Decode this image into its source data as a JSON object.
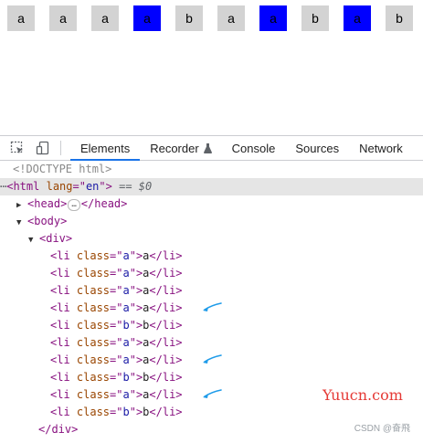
{
  "preview": {
    "boxes": [
      {
        "text": "a",
        "highlight": false
      },
      {
        "text": "a",
        "highlight": false
      },
      {
        "text": "a",
        "highlight": false
      },
      {
        "text": "a",
        "highlight": true
      },
      {
        "text": "b",
        "highlight": false
      },
      {
        "text": "a",
        "highlight": false
      },
      {
        "text": "a",
        "highlight": true
      },
      {
        "text": "b",
        "highlight": false
      },
      {
        "text": "a",
        "highlight": true
      },
      {
        "text": "b",
        "highlight": false
      }
    ],
    "colors": {
      "gray": "#d3d3d3",
      "blue": "#0000ff"
    }
  },
  "devtools": {
    "tabs": [
      "Elements",
      "Recorder",
      "Console",
      "Sources",
      "Network"
    ],
    "active_tab": "Elements",
    "recorder_icon": "flask-icon",
    "toolbar_icons": [
      "inspect-element-icon",
      "device-toggle-icon"
    ],
    "dom": {
      "doctype": "<!DOCTYPE html>",
      "html_lang": "en",
      "selected_marker": "== $0",
      "head_label": "head",
      "body_label": "body",
      "div_label": "div",
      "items": [
        {
          "class": "a",
          "text": "a",
          "arrow": false
        },
        {
          "class": "a",
          "text": "a",
          "arrow": false
        },
        {
          "class": "a",
          "text": "a",
          "arrow": false
        },
        {
          "class": "a",
          "text": "a",
          "arrow": true
        },
        {
          "class": "b",
          "text": "b",
          "arrow": false
        },
        {
          "class": "a",
          "text": "a",
          "arrow": false
        },
        {
          "class": "a",
          "text": "a",
          "arrow": true
        },
        {
          "class": "b",
          "text": "b",
          "arrow": false
        },
        {
          "class": "a",
          "text": "a",
          "arrow": true
        },
        {
          "class": "b",
          "text": "b",
          "arrow": false
        }
      ]
    },
    "accent_color": "#1a73e8",
    "arrow_color": "#1e9be9"
  },
  "watermark": "Yuucn.com",
  "csdn_credit": "CSDN @奋飛"
}
